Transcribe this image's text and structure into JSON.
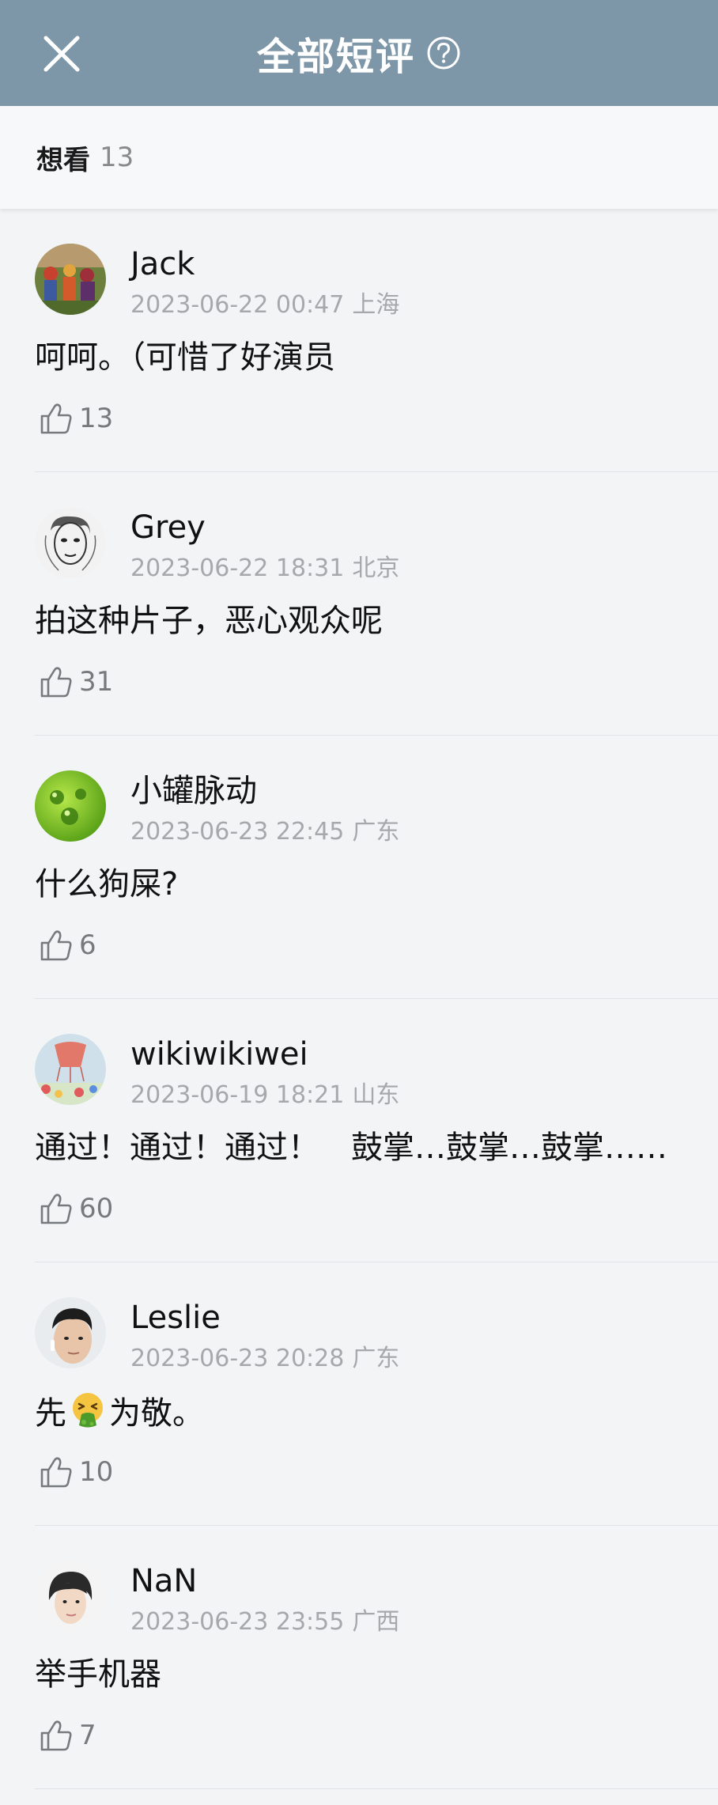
{
  "header": {
    "title": "全部短评"
  },
  "subbar": {
    "label": "想看",
    "count": "13"
  },
  "reviews": [
    {
      "user": "Jack",
      "date": "2023-06-22 00:47",
      "location": "上海",
      "text": "呵呵。（可惜了好演员",
      "likes": "13"
    },
    {
      "user": "Grey",
      "date": "2023-06-22 18:31",
      "location": "北京",
      "text": "拍这种片子，恶心观众呢",
      "likes": "31"
    },
    {
      "user": "小罐脉动",
      "date": "2023-06-23 22:45",
      "location": "广东",
      "text": "什么狗屎?",
      "likes": "6"
    },
    {
      "user": "wikiwikiwei",
      "date": "2023-06-19 18:21",
      "location": "山东",
      "text": "通过！通过！通过！　鼓掌…鼓掌…鼓掌……",
      "likes": "60"
    },
    {
      "user": "Leslie",
      "date": "2023-06-23 20:28",
      "location": "广东",
      "text_before": "先",
      "emoji": "vomiting-face-emoji",
      "text_after": "为敬。",
      "likes": "10"
    },
    {
      "user": "NaN",
      "date": "2023-06-23 23:55",
      "location": "广西",
      "text": "举手机器",
      "likes": "7"
    }
  ]
}
